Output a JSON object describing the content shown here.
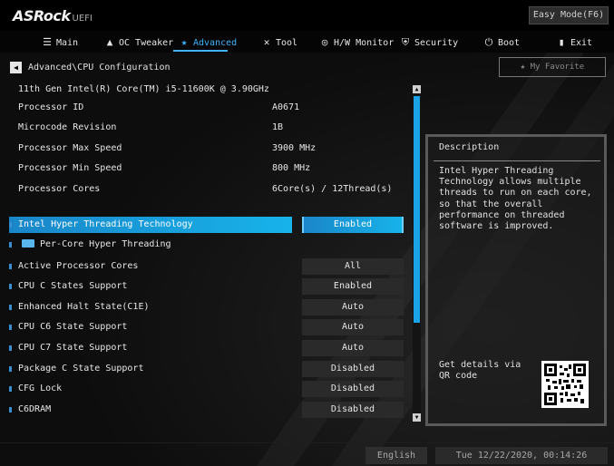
{
  "header": {
    "brand": "ASRock",
    "brand_suffix": "UEFI",
    "easy_mode_label": "Easy Mode(F6)"
  },
  "tabs": [
    {
      "label": "Main",
      "icon": "list-icon",
      "active": false
    },
    {
      "label": "OC Tweaker",
      "icon": "rocket-icon",
      "active": false
    },
    {
      "label": "Advanced",
      "icon": "star-icon",
      "active": true
    },
    {
      "label": "Tool",
      "icon": "tools-icon",
      "active": false
    },
    {
      "label": "H/W Monitor",
      "icon": "monitor-icon",
      "active": false
    },
    {
      "label": "Security",
      "icon": "shield-icon",
      "active": false
    },
    {
      "label": "Boot",
      "icon": "power-icon",
      "active": false
    },
    {
      "label": "Exit",
      "icon": "exit-icon",
      "active": false
    }
  ],
  "breadcrumb": "Advanced\\CPU Configuration",
  "favorite_label": "My Favorite",
  "info": {
    "cpu_name": "11th Gen Intel(R) Core(TM) i5-11600K @ 3.90GHz",
    "rows": [
      {
        "label": "Processor ID",
        "value": "A0671"
      },
      {
        "label": "Microcode Revision",
        "value": "1B"
      },
      {
        "label": "Processor Max Speed",
        "value": "3900 MHz"
      },
      {
        "label": "Processor Min Speed",
        "value": "800 MHz"
      },
      {
        "label": "Processor Cores",
        "value": "6Core(s) / 12Thread(s)"
      }
    ]
  },
  "settings": [
    {
      "label": "Intel Hyper Threading Technology",
      "value": "Enabled",
      "selected": true
    },
    {
      "label": "Per-Core Hyper Threading",
      "submenu": true
    },
    {
      "label": "Active Processor Cores",
      "value": "All"
    },
    {
      "label": "CPU C States Support",
      "value": "Enabled"
    },
    {
      "label": " Enhanced Halt State(C1E)",
      "value": "Auto"
    },
    {
      "label": " CPU C6 State Support",
      "value": "Auto"
    },
    {
      "label": " CPU C7 State Support",
      "value": "Auto"
    },
    {
      "label": " Package C State Support",
      "value": "Disabled"
    },
    {
      "label": " CFG Lock",
      "value": "Disabled"
    },
    {
      "label": "C6DRAM",
      "value": "Disabled"
    }
  ],
  "description": {
    "title": "Description",
    "text": "Intel Hyper Threading Technology allows multiple threads to run on each core, so that the overall performance on threaded software is improved.",
    "qr_text": "Get details via QR code"
  },
  "footer": {
    "language": "English",
    "datetime": "Tue 12/22/2020, 00:14:26"
  },
  "colors": {
    "accent": "#1aa3e6",
    "active_tab": "#3fb4ff"
  }
}
